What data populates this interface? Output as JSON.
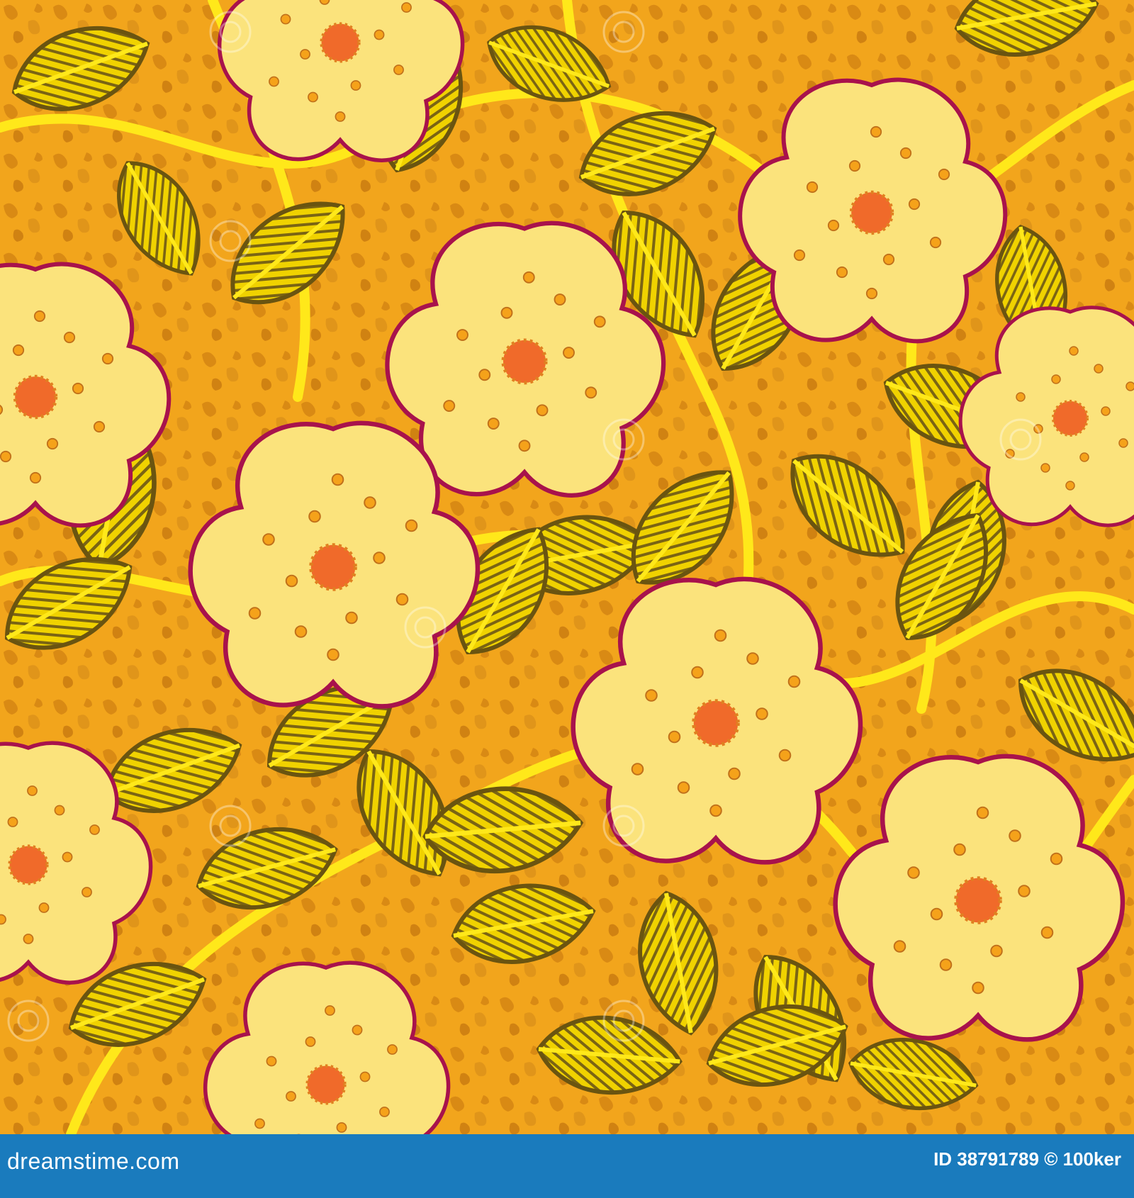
{
  "image": {
    "subject": "seamless floral pattern",
    "palette": {
      "background": "#f2a51c",
      "texture": "#d98a14",
      "stems": "#ffe81a",
      "leaf_fill": "#f0d200",
      "leaf_lines": "#7a6414",
      "petal": "#fbe37c",
      "petal_outline": "#a8124c",
      "stamen_dot": "#f5a21a",
      "center": "#f06a2a"
    },
    "watermark": "dreamstime"
  },
  "footer": {
    "site": "dreamstime.com",
    "credit": "ID 38791789 © 100ker",
    "color": "#1a7bbd"
  }
}
